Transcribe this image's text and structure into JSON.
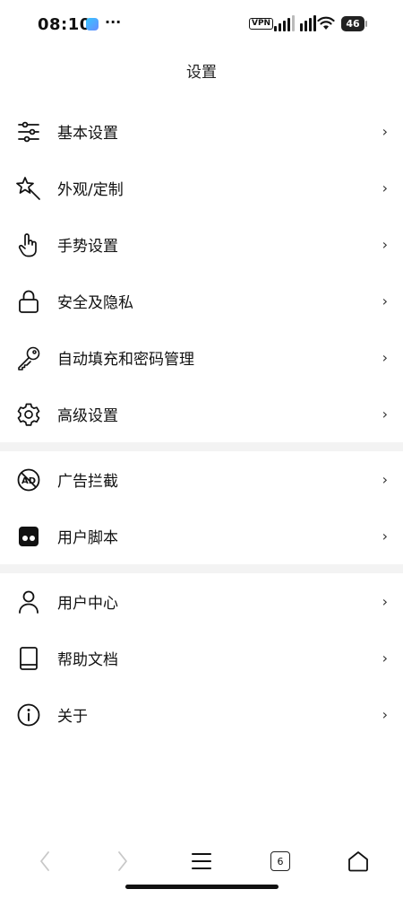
{
  "status_bar": {
    "time": "08:10",
    "more": "···",
    "vpn": "VPN",
    "battery": "46"
  },
  "header": {
    "title": "设置"
  },
  "menu": {
    "group1": [
      {
        "label": "基本设置",
        "icon": "sliders-icon"
      },
      {
        "label": "外观/定制",
        "icon": "magic-wand-icon"
      },
      {
        "label": "手势设置",
        "icon": "hand-pointer-icon"
      },
      {
        "label": "安全及隐私",
        "icon": "lock-icon"
      },
      {
        "label": "自动填充和密码管理",
        "icon": "key-icon"
      },
      {
        "label": "高级设置",
        "icon": "gear-icon"
      }
    ],
    "group2": [
      {
        "label": "广告拦截",
        "icon": "ad-block-icon"
      },
      {
        "label": "用户脚本",
        "icon": "user-script-icon"
      }
    ],
    "group3": [
      {
        "label": "用户中心",
        "icon": "user-icon"
      },
      {
        "label": "帮助文档",
        "icon": "book-icon"
      },
      {
        "label": "关于",
        "icon": "info-icon"
      }
    ],
    "chevron": "›"
  },
  "bottom_nav": {
    "tab_count": "6"
  }
}
